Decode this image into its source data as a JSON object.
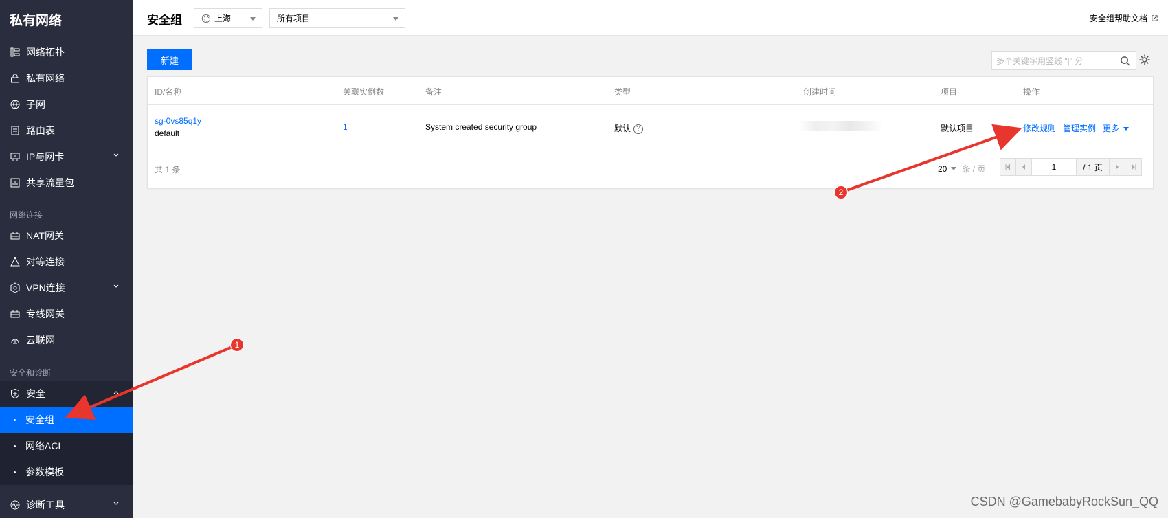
{
  "sidebar": {
    "title": "私有网络",
    "items": [
      {
        "label": "网络拓扑",
        "icon": "topology-icon"
      },
      {
        "label": "私有网络",
        "icon": "lock-network-icon"
      },
      {
        "label": "子网",
        "icon": "globe-icon"
      },
      {
        "label": "路由表",
        "icon": "route-table-icon"
      },
      {
        "label": "IP与网卡",
        "icon": "ip-nic-icon"
      },
      {
        "label": "共享流量包",
        "icon": "traffic-chart-icon"
      }
    ],
    "group_network_conn": "网络连接",
    "conn_items": [
      {
        "label": "NAT网关",
        "icon": "gateway-icon"
      },
      {
        "label": "对等连接",
        "icon": "peering-icon"
      },
      {
        "label": "VPN连接",
        "icon": "vpn-icon"
      },
      {
        "label": "专线网关",
        "icon": "gateway-icon"
      },
      {
        "label": "云联网",
        "icon": "cloud-network-icon"
      }
    ],
    "group_security": "安全和诊断",
    "security": {
      "label": "安全",
      "icon": "shield-icon"
    },
    "security_subs": [
      "安全组",
      "网络ACL",
      "参数模板"
    ],
    "diag": {
      "label": "诊断工具",
      "icon": "pulse-icon"
    }
  },
  "topbar": {
    "title": "安全组",
    "region": "上海",
    "project": "所有项目",
    "help": "安全组帮助文档"
  },
  "toolbar": {
    "new_button": "新建",
    "search_placeholder": "多个关键字用竖线 \"|\" 分"
  },
  "table": {
    "headers": [
      "ID/名称",
      "关联实例数",
      "备注",
      "类型",
      "创建时间",
      "项目",
      "操作"
    ],
    "row": {
      "id": "sg-0vs85q1y",
      "name": "default",
      "instances": "1",
      "remark": "System created security group",
      "type": "默认",
      "project": "默认项目",
      "action_edit": "修改规则",
      "action_manage": "管理实例",
      "action_more": "更多"
    },
    "total": "共 1 条",
    "page_size": "20",
    "page_size_unit": "条 / 页",
    "page_current": "1",
    "page_total": "/ 1 页"
  },
  "annotations": {
    "badge1": "1",
    "badge2": "2",
    "arrow_color": "#e8352d"
  },
  "watermark": "CSDN @GamebabyRockSun_QQ",
  "colors": {
    "accent": "#006eff",
    "sidebar": "#292d3e"
  }
}
